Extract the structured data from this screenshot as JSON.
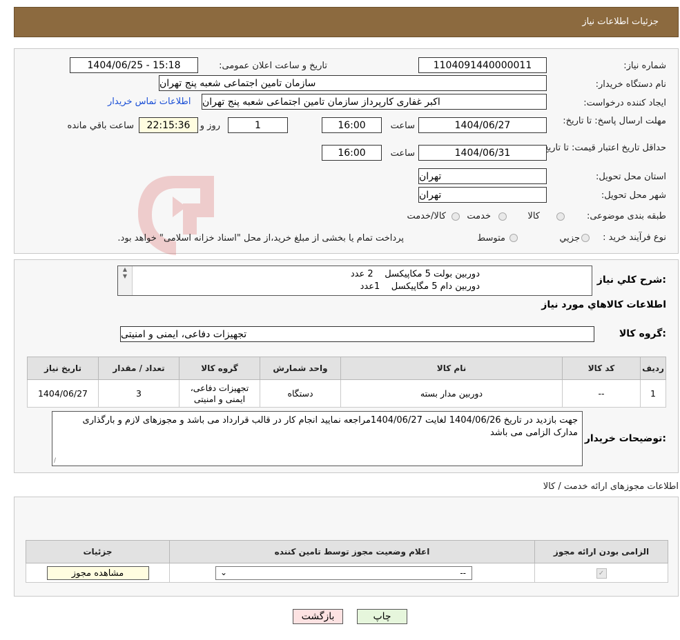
{
  "header": {
    "title": "جزئیات اطلاعات نیاز"
  },
  "form": {
    "need_number_label": "شماره نیاز:",
    "need_number": "1104091440000011",
    "announce_label": "تاریخ و ساعت اعلان عمومی:",
    "announce_value": "1404/06/25 - 15:18",
    "buyer_org_label": "نام دستگاه خریدار:",
    "buyer_org": "سازمان تامین اجتماعی شعبه پنج تهران",
    "creator_label": "ایجاد کننده درخواست:",
    "creator": "اکبر غفاری کارپرداز  سازمان تامین اجتماعی شعبه پنج تهران",
    "contact_link": "اطلاعات تماس خریدار",
    "deadline_label": "مهلت ارسال پاسخ: تا تاریخ:",
    "deadline_date": "1404/06/27",
    "time_label": "ساعت",
    "deadline_time": "16:00",
    "days_value": "1",
    "days_label": "روز و",
    "remaining_time": "22:15:36",
    "remaining_label": "ساعت باقي مانده",
    "validity_label": "حداقل تاریخ اعتبار قیمت: تا تاریخ:",
    "validity_date": "1404/06/31",
    "validity_time": "16:00",
    "province_label": "استان محل تحویل:",
    "province": "تهران",
    "city_label": "شهر محل تحویل:",
    "city": "تهران",
    "category_label": "طبقه بندی موضوعی:",
    "category_options": [
      "کالا",
      "خدمت",
      "کالا/خدمت"
    ],
    "process_label": "نوع فرآیند خرید :",
    "process_options": [
      "جزيي",
      "متوسط"
    ],
    "process_note": "پرداخت تمام یا بخشی از مبلغ خرید،از محل \"اسناد خزانه اسلامی\" خواهد بود."
  },
  "description": {
    "label": "شرح کلي نياز:",
    "line1": "دوربین بولت 5 مکاپیکسل    2 عدد",
    "line2": "دوربین دام 5 مگاپیکسل    1عدد"
  },
  "goods": {
    "section_title": "اطلاعات کالاهاي مورد نياز",
    "group_label": "گروه کالا:",
    "group_value": "تجهیزات دفاعی، ایمنی و امنیتی",
    "columns": [
      "رديف",
      "کد کالا",
      "نام کالا",
      "واحد شمارش",
      "گروه کالا",
      "تعداد / مقدار",
      "تاریخ نیاز"
    ],
    "rows": [
      {
        "row": "1",
        "code": "--",
        "name": "دوربین مدار بسته",
        "unit": "دستگاه",
        "group": "تجهیزات دفاعی، ایمنی و امنیتی",
        "qty": "3",
        "date": "1404/06/27"
      }
    ]
  },
  "buyer_notes": {
    "label": "توضیحات خریدار:",
    "text": "جهت بازدید در تاریخ 1404/06/26 لغایت 1404/06/27مراجعه نمایید انجام کار در قالب قرارداد می باشد و مجوزهای لازم و بارگذاری مدارک الزامی می باشد"
  },
  "permits": {
    "section_title": "اطلاعات مجوزهای ارائه خدمت / کالا",
    "columns": [
      "الزامی بودن ارائه مجوز",
      "اعلام وضعیت مجوز توسط تامین کننده",
      "جزئیات"
    ],
    "select_value": "--",
    "view_button": "مشاهده مجوز"
  },
  "buttons": {
    "print": "چاپ",
    "back": "بازگشت"
  },
  "colors": {
    "header": "#8c6a3f",
    "link": "#1a4fd6",
    "back_button": "#fde2e2",
    "print_button": "#e6f6dc"
  }
}
